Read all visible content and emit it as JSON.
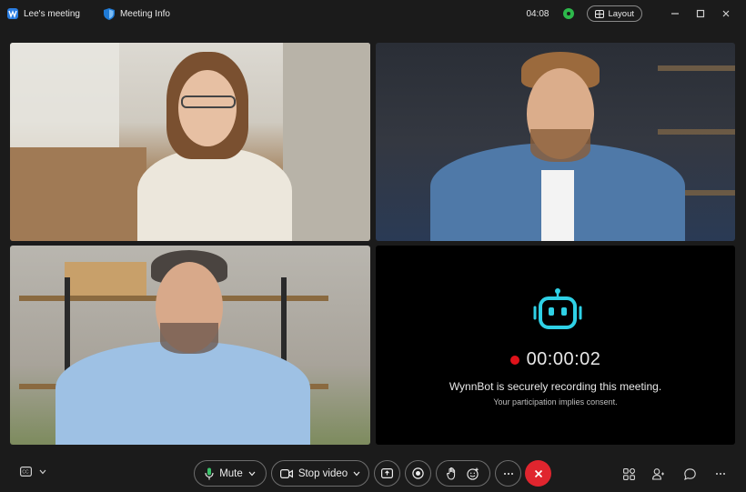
{
  "titlebar": {
    "app_name": "Lee's meeting",
    "info_label": "Meeting Info",
    "timer": "04:08",
    "layout_label": "Layout"
  },
  "bot": {
    "recording_time": "00:00:02",
    "message": "WynnBot is securely recording this meeting.",
    "sub_message": "Your participation implies consent."
  },
  "toolbar": {
    "mute_label": "Mute",
    "stop_video_label": "Stop video"
  },
  "colors": {
    "accent_green": "#2db84b",
    "end_red": "#e0252e",
    "bot_cyan": "#2fd1e6",
    "rec_red": "#e0121a"
  },
  "icons": [
    "app-logo-icon",
    "shield-icon",
    "layout-icon",
    "minimize-icon",
    "maximize-icon",
    "close-icon",
    "captions-icon",
    "microphone-icon",
    "video-camera-icon",
    "share-icon",
    "record-icon",
    "raise-hand-icon",
    "reactions-icon",
    "more-icon",
    "end-call-icon",
    "apps-icon",
    "participants-icon",
    "chat-icon",
    "overflow-icon",
    "robot-icon"
  ]
}
